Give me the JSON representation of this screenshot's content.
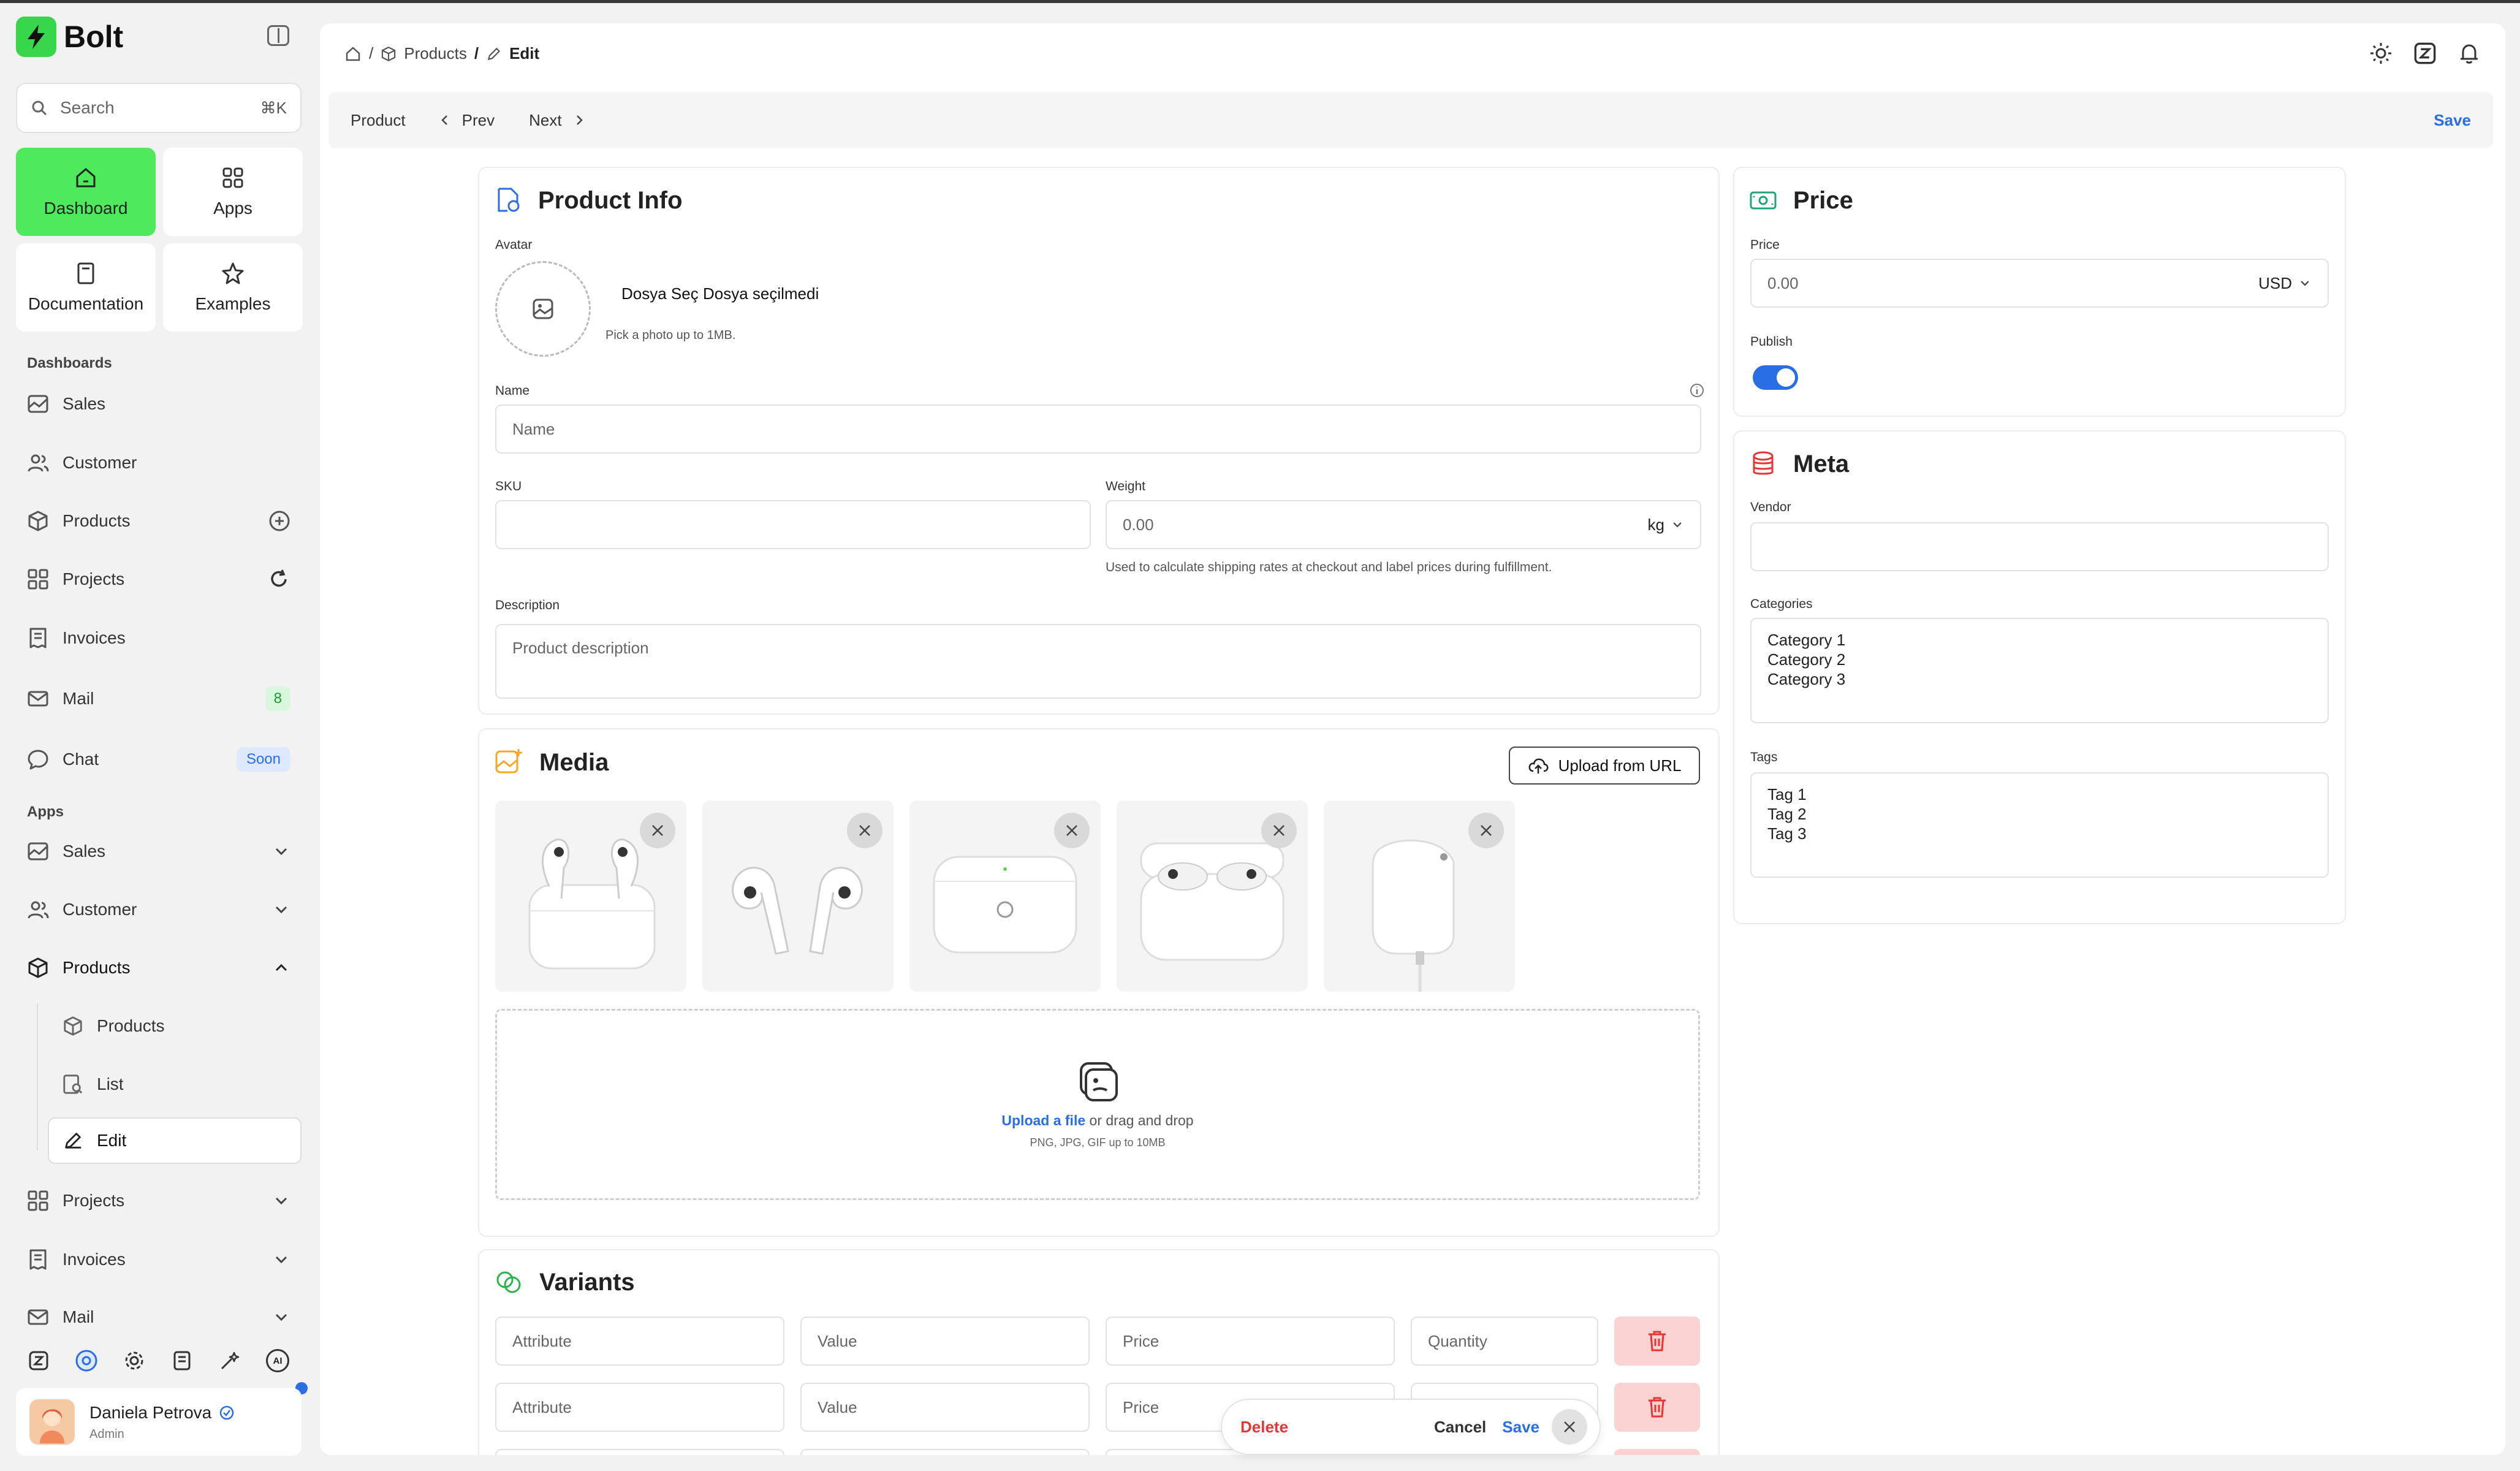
{
  "app": {
    "name": "Bolt"
  },
  "search": {
    "placeholder": "Search",
    "shortcut": "⌘K"
  },
  "tiles": [
    {
      "label": "Dashboard",
      "icon": "home-icon"
    },
    {
      "label": "Apps",
      "icon": "apps-icon"
    },
    {
      "label": "Documentation",
      "icon": "book-icon"
    },
    {
      "label": "Examples",
      "icon": "star-icon"
    }
  ],
  "sidebar": {
    "dashboards_label": "Dashboards",
    "dashboards": [
      {
        "label": "Sales"
      },
      {
        "label": "Customer"
      },
      {
        "label": "Products"
      },
      {
        "label": "Projects"
      },
      {
        "label": "Invoices"
      },
      {
        "label": "Mail",
        "badge": "8"
      },
      {
        "label": "Chat",
        "badge": "Soon"
      }
    ],
    "apps_label": "Apps",
    "apps": [
      {
        "label": "Sales"
      },
      {
        "label": "Customer"
      },
      {
        "label": "Products"
      }
    ],
    "product_sub": [
      {
        "label": "Products"
      },
      {
        "label": "List"
      },
      {
        "label": "Edit"
      }
    ],
    "apps_more": [
      {
        "label": "Projects"
      },
      {
        "label": "Invoices"
      },
      {
        "label": "Mail"
      }
    ],
    "bottom_ai": "AI"
  },
  "user": {
    "name": "Daniela Petrova",
    "role": "Admin"
  },
  "breadcrumb": {
    "sep": "/",
    "products": "Products",
    "current": "Edit"
  },
  "subbar": {
    "product": "Product",
    "prev": "Prev",
    "next": "Next",
    "save": "Save"
  },
  "product_info": {
    "title": "Product Info",
    "avatar_label": "Avatar",
    "file_choose": "Dosya Seç",
    "file_none": "Dosya seçilmedi",
    "file_help": "Pick a photo up to 1MB.",
    "name_label": "Name",
    "name_placeholder": "Name",
    "sku_label": "SKU",
    "weight_label": "Weight",
    "weight_placeholder": "0.00",
    "weight_unit": "kg",
    "weight_help": "Used to calculate shipping rates at checkout and label prices during fulfillment.",
    "description_label": "Description",
    "description_placeholder": "Product description"
  },
  "media": {
    "title": "Media",
    "upload_url": "Upload from URL",
    "upload_link": "Upload a file",
    "upload_text": "or drag and drop",
    "upload_help": "PNG, JPG, GIF up to 10MB"
  },
  "variants": {
    "title": "Variants",
    "attribute_placeholder": "Attribute",
    "value_placeholder": "Value",
    "price_placeholder": "Price",
    "quantity_placeholder": "Quantity"
  },
  "price": {
    "title": "Price",
    "price_label": "Price",
    "price_placeholder": "0.00",
    "currency": "USD",
    "publish_label": "Publish",
    "publish_on": true
  },
  "meta": {
    "title": "Meta",
    "vendor_label": "Vendor",
    "categories_label": "Categories",
    "categories": [
      "Category 1",
      "Category 2",
      "Category 3"
    ],
    "tags_label": "Tags",
    "tags": [
      "Tag 1",
      "Tag 2",
      "Tag 3"
    ]
  },
  "toast": {
    "delete": "Delete",
    "cancel": "Cancel",
    "save": "Save"
  },
  "colors": {
    "accent": "#2a6ee6",
    "brand": "#38d64a",
    "danger": "#e63535",
    "active_tile": "#4ee95c"
  }
}
